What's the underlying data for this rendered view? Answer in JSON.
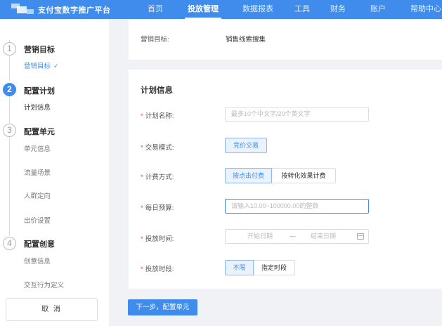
{
  "header": {
    "brand": "支付宝数字推广平台",
    "nav": [
      {
        "label": "首页",
        "active": false
      },
      {
        "label": "投放管理",
        "active": true
      },
      {
        "label": "数据报表",
        "active": false
      },
      {
        "label": "工具",
        "active": false
      },
      {
        "label": "财务",
        "active": false
      },
      {
        "label": "账户",
        "active": false
      },
      {
        "label": "帮助中心",
        "active": false
      }
    ]
  },
  "sidebar": {
    "steps": [
      {
        "num": "1",
        "title": "营销目标",
        "items": [
          "营销目标"
        ]
      },
      {
        "num": "2",
        "title": "配置计划",
        "items": [
          "计划信息"
        ]
      },
      {
        "num": "3",
        "title": "配置单元",
        "items": [
          "单元信息",
          "流量场景",
          "人群定向",
          "出价设置"
        ]
      },
      {
        "num": "4",
        "title": "配置创意",
        "items": [
          "创意信息",
          "交互行为定义"
        ]
      }
    ],
    "check_icon": "✓",
    "cancel_label": "取 消"
  },
  "goal": {
    "label": "营销目标:",
    "value": "销售线索搜集"
  },
  "plan": {
    "title": "计划信息",
    "required_mark": "*",
    "name": {
      "label": "计划名称:",
      "placeholder": "最多10个中文字/20个英文字"
    },
    "trade_mode": {
      "label": "交易模式:",
      "option": "竞价交易"
    },
    "billing": {
      "label": "计费方式:",
      "options": [
        "按点击付费",
        "按转化效果计费"
      ],
      "selected": "按点击付费"
    },
    "budget": {
      "label": "每日预算:",
      "placeholder": "请输入10.00~100000.00的整数"
    },
    "period": {
      "label": "投放时间:",
      "start_placeholder": "开始日期",
      "separator": "—",
      "end_placeholder": "结束日期"
    },
    "slot": {
      "label": "投放时段:",
      "options": [
        "不限",
        "指定时段"
      ],
      "selected": "不限"
    }
  },
  "footer": {
    "next_label": "下一步，配置单元"
  },
  "colors": {
    "primary": "#3f8cec",
    "required": "#e84a3c"
  }
}
